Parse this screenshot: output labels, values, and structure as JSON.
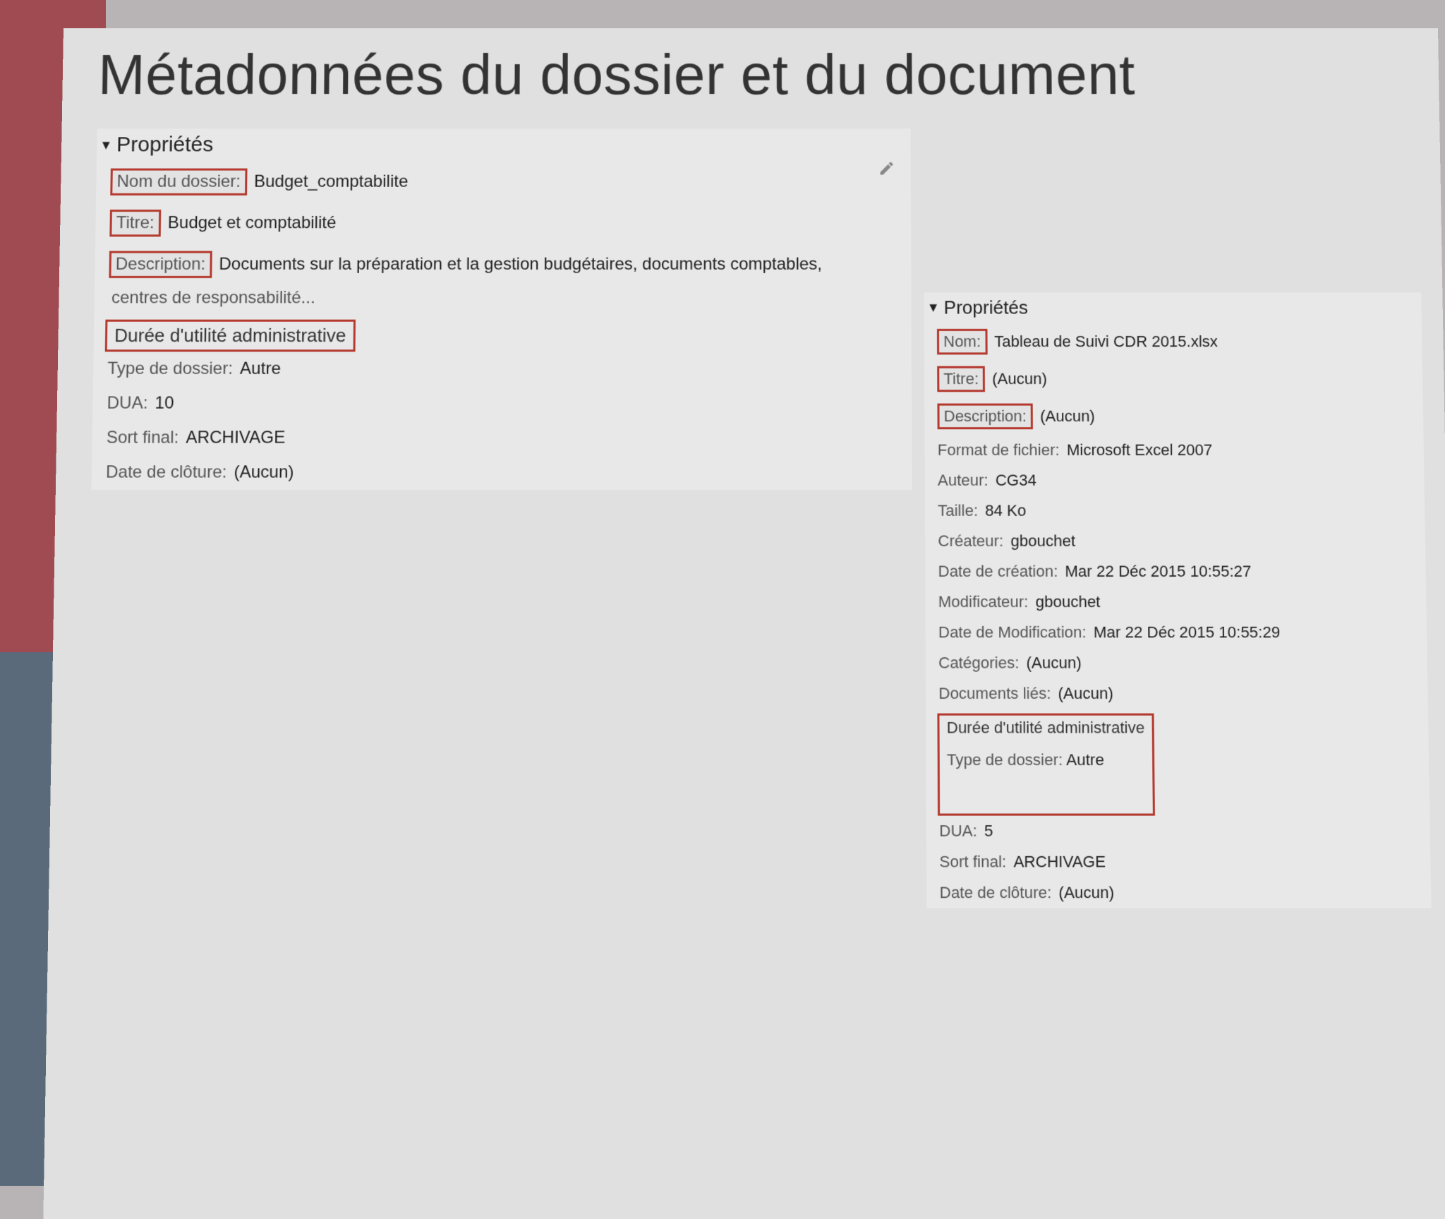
{
  "title": "Métadonnées du dossier et du document",
  "folder": {
    "properties_header": "Propriétés",
    "labels": {
      "name": "Nom du dossier:",
      "title": "Titre:",
      "description": "Description:",
      "dua_section": "Durée d'utilité administrative",
      "folder_type": "Type de dossier:",
      "dua": "DUA:",
      "sort_final": "Sort final:",
      "close_date": "Date de clôture:"
    },
    "values": {
      "name": "Budget_comptabilite",
      "title": "Budget et comptabilité",
      "description_line1": "Documents sur la préparation et la gestion budgétaires, documents comptables,",
      "description_line2": "centres de responsabilité...",
      "folder_type": "Autre",
      "dua": "10",
      "sort_final": "ARCHIVAGE",
      "close_date": "(Aucun)"
    }
  },
  "document": {
    "properties_header": "Propriétés",
    "labels": {
      "name": "Nom:",
      "title": "Titre:",
      "description": "Description:",
      "file_format": "Format de fichier:",
      "author": "Auteur:",
      "size": "Taille:",
      "creator": "Créateur:",
      "create_date": "Date de création:",
      "modifier": "Modificateur:",
      "modify_date": "Date de Modification:",
      "categories": "Catégories:",
      "linked_docs": "Documents liés:",
      "dua_section": "Durée d'utilité administrative",
      "folder_type": "Type de dossier:",
      "dua": "DUA:",
      "sort_final": "Sort final:",
      "close_date": "Date de clôture:"
    },
    "values": {
      "name": "Tableau de Suivi CDR 2015.xlsx",
      "title": "(Aucun)",
      "description": "(Aucun)",
      "file_format": "Microsoft Excel 2007",
      "author": "CG34",
      "size": "84 Ko",
      "creator": "gbouchet",
      "create_date": "Mar 22 Déc 2015 10:55:27",
      "modifier": "gbouchet",
      "modify_date": "Mar 22 Déc 2015 10:55:29",
      "categories": "(Aucun)",
      "linked_docs": "(Aucun)",
      "folder_type": "Autre",
      "dua": "5",
      "sort_final": "ARCHIVAGE",
      "close_date": "(Aucun)"
    }
  }
}
